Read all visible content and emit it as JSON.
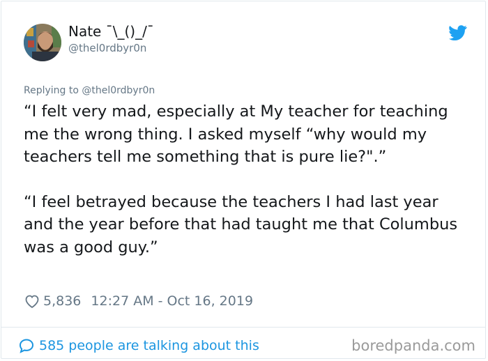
{
  "author": {
    "name": "Nate ¯\\_()_/¯",
    "handle": "@thel0rdbyr0n"
  },
  "tweet": {
    "replying_to": "Replying to @thel0rdbyr0n",
    "paragraphs": [
      "“I felt very mad, especially at My teacher for teaching me the wrong thing.  I asked myself “why would my teachers tell me something that is pure lie?\".”",
      "“I feel betrayed  because the teachers I had last year and the year before that had taught me that Columbus was a good guy.”"
    ],
    "likes": "5,836",
    "timestamp": "12:27 AM - Oct 16, 2019"
  },
  "footer": {
    "conversation_text": "585 people are talking about this"
  },
  "watermark": "boredpanda.com",
  "colors": {
    "link_blue": "#1b95e0",
    "secondary_text": "#657786",
    "primary_text": "#14171a",
    "twitter_blue": "#1da1f2"
  },
  "icons": {
    "brand": "twitter-bird-icon",
    "like": "heart-icon",
    "conversation": "speech-bubble-icon"
  }
}
